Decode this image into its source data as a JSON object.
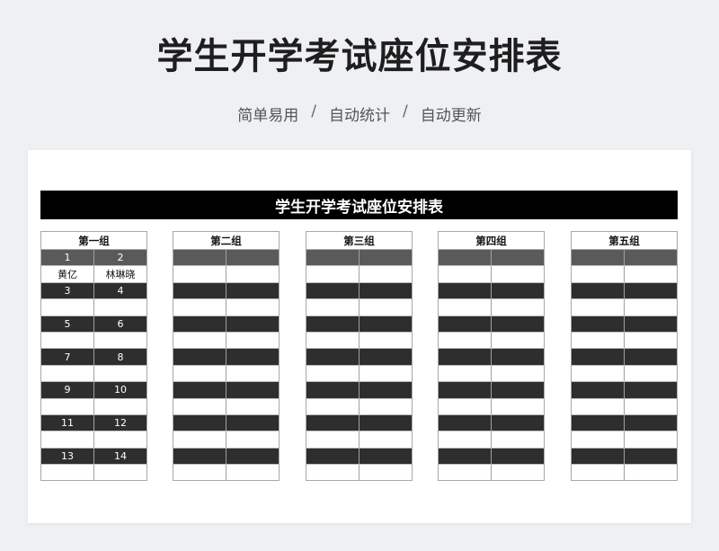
{
  "page": {
    "title": "学生开学考试座位安排表",
    "tags": [
      "简单易用",
      "自动统计",
      "自动更新"
    ],
    "separator": "/"
  },
  "sheet": {
    "banner": "学生开学考试座位安排表",
    "groups": [
      {
        "name": "第一组",
        "pairs": [
          {
            "nums": [
              "1",
              "2"
            ],
            "names": [
              "黄亿",
              "林琳晓"
            ]
          },
          {
            "nums": [
              "3",
              "4"
            ],
            "names": [
              "",
              ""
            ]
          },
          {
            "nums": [
              "5",
              "6"
            ],
            "names": [
              "",
              ""
            ]
          },
          {
            "nums": [
              "7",
              "8"
            ],
            "names": [
              "",
              ""
            ]
          },
          {
            "nums": [
              "9",
              "10"
            ],
            "names": [
              "",
              ""
            ]
          },
          {
            "nums": [
              "11",
              "12"
            ],
            "names": [
              "",
              ""
            ]
          },
          {
            "nums": [
              "13",
              "14"
            ],
            "names": [
              "",
              ""
            ]
          }
        ]
      },
      {
        "name": "第二组",
        "pairs": [
          {
            "nums": [
              "",
              ""
            ],
            "names": [
              "",
              ""
            ]
          },
          {
            "nums": [
              "",
              ""
            ],
            "names": [
              "",
              ""
            ]
          },
          {
            "nums": [
              "",
              ""
            ],
            "names": [
              "",
              ""
            ]
          },
          {
            "nums": [
              "",
              ""
            ],
            "names": [
              "",
              ""
            ]
          },
          {
            "nums": [
              "",
              ""
            ],
            "names": [
              "",
              ""
            ]
          },
          {
            "nums": [
              "",
              ""
            ],
            "names": [
              "",
              ""
            ]
          },
          {
            "nums": [
              "",
              ""
            ],
            "names": [
              "",
              ""
            ]
          }
        ]
      },
      {
        "name": "第三组",
        "pairs": [
          {
            "nums": [
              "",
              ""
            ],
            "names": [
              "",
              ""
            ]
          },
          {
            "nums": [
              "",
              ""
            ],
            "names": [
              "",
              ""
            ]
          },
          {
            "nums": [
              "",
              ""
            ],
            "names": [
              "",
              ""
            ]
          },
          {
            "nums": [
              "",
              ""
            ],
            "names": [
              "",
              ""
            ]
          },
          {
            "nums": [
              "",
              ""
            ],
            "names": [
              "",
              ""
            ]
          },
          {
            "nums": [
              "",
              ""
            ],
            "names": [
              "",
              ""
            ]
          },
          {
            "nums": [
              "",
              ""
            ],
            "names": [
              "",
              ""
            ]
          }
        ]
      },
      {
        "name": "第四组",
        "pairs": [
          {
            "nums": [
              "",
              ""
            ],
            "names": [
              "",
              ""
            ]
          },
          {
            "nums": [
              "",
              ""
            ],
            "names": [
              "",
              ""
            ]
          },
          {
            "nums": [
              "",
              ""
            ],
            "names": [
              "",
              ""
            ]
          },
          {
            "nums": [
              "",
              ""
            ],
            "names": [
              "",
              ""
            ]
          },
          {
            "nums": [
              "",
              ""
            ],
            "names": [
              "",
              ""
            ]
          },
          {
            "nums": [
              "",
              ""
            ],
            "names": [
              "",
              ""
            ]
          },
          {
            "nums": [
              "",
              ""
            ],
            "names": [
              "",
              ""
            ]
          }
        ]
      },
      {
        "name": "第五组",
        "pairs": [
          {
            "nums": [
              "",
              ""
            ],
            "names": [
              "",
              ""
            ]
          },
          {
            "nums": [
              "",
              ""
            ],
            "names": [
              "",
              ""
            ]
          },
          {
            "nums": [
              "",
              ""
            ],
            "names": [
              "",
              ""
            ]
          },
          {
            "nums": [
              "",
              ""
            ],
            "names": [
              "",
              ""
            ]
          },
          {
            "nums": [
              "",
              ""
            ],
            "names": [
              "",
              ""
            ]
          },
          {
            "nums": [
              "",
              ""
            ],
            "names": [
              "",
              ""
            ]
          },
          {
            "nums": [
              "",
              ""
            ],
            "names": [
              "",
              ""
            ]
          }
        ]
      }
    ]
  },
  "colors": {
    "banner_bg": "#000000",
    "first_number_row": "#5a5a5a",
    "number_row": "#2e2e2e",
    "page_bg": "#eef0f3"
  }
}
